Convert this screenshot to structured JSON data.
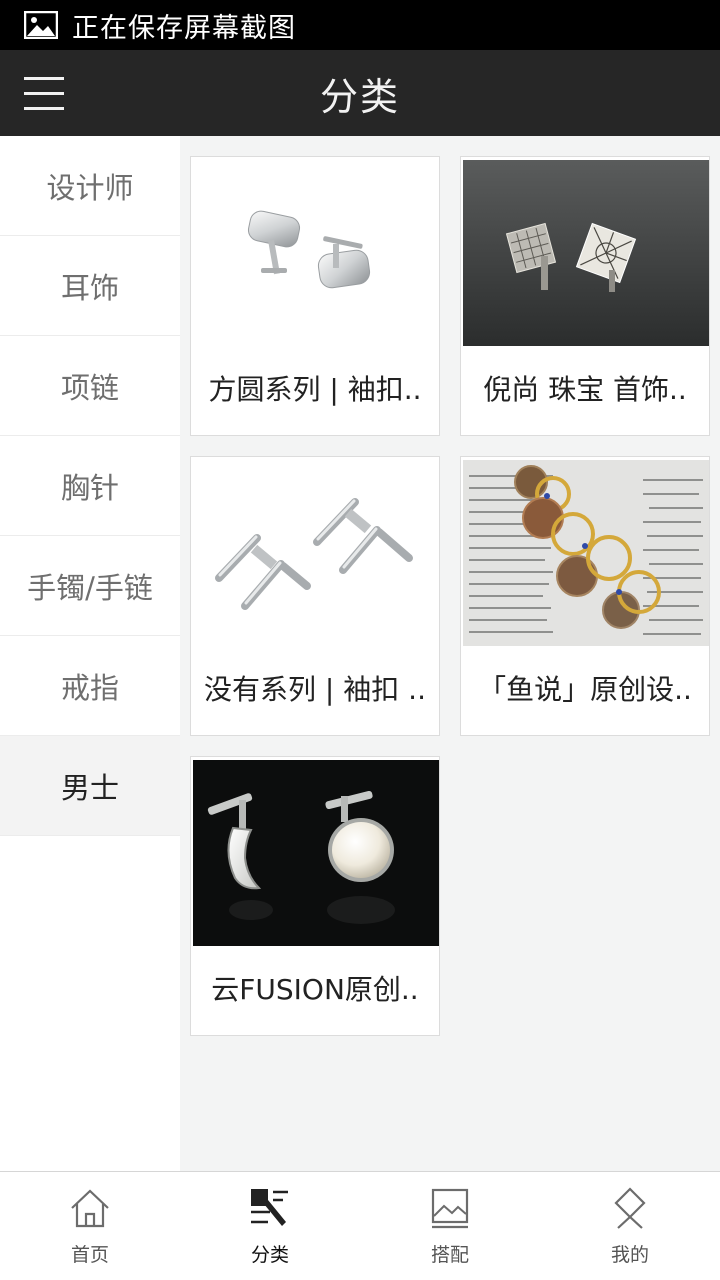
{
  "status_bar": {
    "text": "正在保存屏幕截图",
    "icon": "image-icon"
  },
  "header": {
    "title": "分类",
    "menu_icon": "hamburger-menu-icon"
  },
  "sidebar": {
    "items": [
      {
        "label": "设计师",
        "active": false
      },
      {
        "label": "耳饰",
        "active": false
      },
      {
        "label": "项链",
        "active": false
      },
      {
        "label": "胸针",
        "active": false
      },
      {
        "label": "手镯/手链",
        "active": false
      },
      {
        "label": "戒指",
        "active": false
      },
      {
        "label": "男士",
        "active": true
      }
    ]
  },
  "products": [
    {
      "caption": "方圆系列 | 袖扣..",
      "image": "silver-cufflinks-rounded-square"
    },
    {
      "caption": "倪尚 珠宝 首饰..",
      "image": "silver-filigree-cufflinks-dark"
    },
    {
      "caption": "没有系列 | 袖扣 ..",
      "image": "silver-bar-cufflinks"
    },
    {
      "caption": "「鱼说」原创设..",
      "image": "coin-rings-on-newspaper"
    },
    {
      "caption": "云FUSION原创..",
      "image": "moon-pearl-cufflinks-black"
    }
  ],
  "bottom_nav": {
    "tabs": [
      {
        "label": "首页",
        "icon": "home-icon",
        "active": false
      },
      {
        "label": "分类",
        "icon": "category-icon",
        "active": true
      },
      {
        "label": "搭配",
        "icon": "picture-frame-icon",
        "active": false
      },
      {
        "label": "我的",
        "icon": "profile-diamond-icon",
        "active": false
      }
    ]
  },
  "colors": {
    "header_bg": "#262626",
    "status_bg": "#000000",
    "content_bg": "#f3f4f4",
    "active_side_bg": "#f3f3f3"
  }
}
